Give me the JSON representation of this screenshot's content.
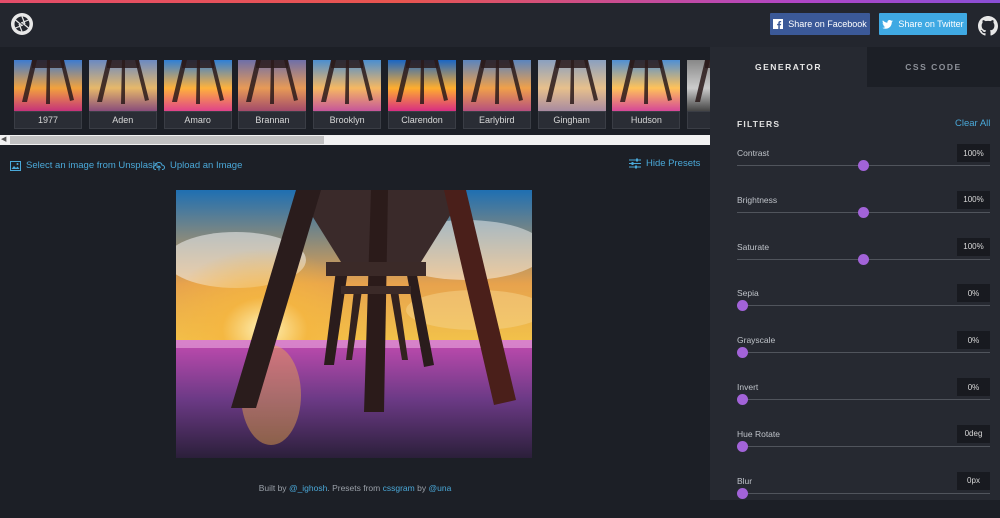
{
  "header": {
    "facebook_label": "Share on Facebook",
    "twitter_label": "Share on Twitter",
    "colors": {
      "facebook": "#3b5998",
      "twitter": "#3fa9e3",
      "accent": "#a263d8",
      "link": "#4aa8d8"
    }
  },
  "presets": [
    "1977",
    "Aden",
    "Amaro",
    "Brannan",
    "Brooklyn",
    "Clarendon",
    "Earlybird",
    "Gingham",
    "Hudson",
    ""
  ],
  "links": {
    "unsplash": "Select an image from Unsplash",
    "upload": "Upload an Image",
    "hide_presets": "Hide Presets"
  },
  "credit": {
    "built_by": "Built by",
    "author": "@_ighosh",
    "presets_from": ". Presets from",
    "source": "cssgram",
    "by": "by",
    "author2": "@una"
  },
  "panel": {
    "tab_generator": "GENERATOR",
    "tab_css": "CSS CODE",
    "filters_title": "FILTERS",
    "clear_all": "Clear All",
    "filters": [
      {
        "name": "Contrast",
        "value": "100%",
        "fraction": 0.5
      },
      {
        "name": "Brightness",
        "value": "100%",
        "fraction": 0.5
      },
      {
        "name": "Saturate",
        "value": "100%",
        "fraction": 0.5
      },
      {
        "name": "Sepia",
        "value": "0%",
        "fraction": 0
      },
      {
        "name": "Grayscale",
        "value": "0%",
        "fraction": 0
      },
      {
        "name": "Invert",
        "value": "0%",
        "fraction": 0
      },
      {
        "name": "Hue Rotate",
        "value": "0deg",
        "fraction": 0
      },
      {
        "name": "Blur",
        "value": "0px",
        "fraction": 0
      }
    ]
  }
}
